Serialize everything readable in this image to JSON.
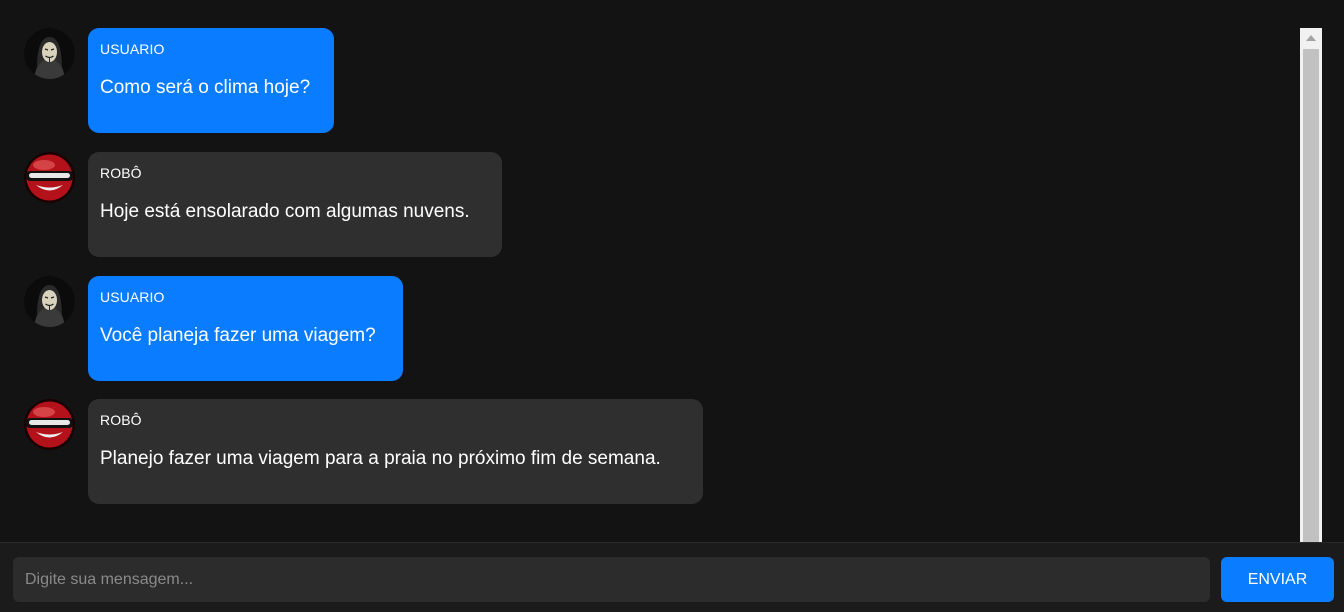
{
  "messages": [
    {
      "role": "user",
      "avatar_icon": "anonymous-mask-avatar",
      "sender": "USUARIO",
      "text": "Como será o clima hoje?"
    },
    {
      "role": "bot",
      "avatar_icon": "red-robot-avatar",
      "sender": "ROBÔ",
      "text": "Hoje está ensolarado com algumas nuvens."
    },
    {
      "role": "user",
      "avatar_icon": "anonymous-mask-avatar",
      "sender": "USUARIO",
      "text": "Você planeja fazer uma viagem?"
    },
    {
      "role": "bot",
      "avatar_icon": "red-robot-avatar",
      "sender": "ROBÔ",
      "text": "Planejo fazer uma viagem para a praia no próximo fim de semana."
    }
  ],
  "composer": {
    "placeholder": "Digite sua mensagem...",
    "value": "",
    "send_label": "ENVIAR"
  },
  "colors": {
    "background": "#131313",
    "user_bubble": "#0a7cff",
    "bot_bubble": "#2f2f2f",
    "button": "#0a7cff"
  }
}
